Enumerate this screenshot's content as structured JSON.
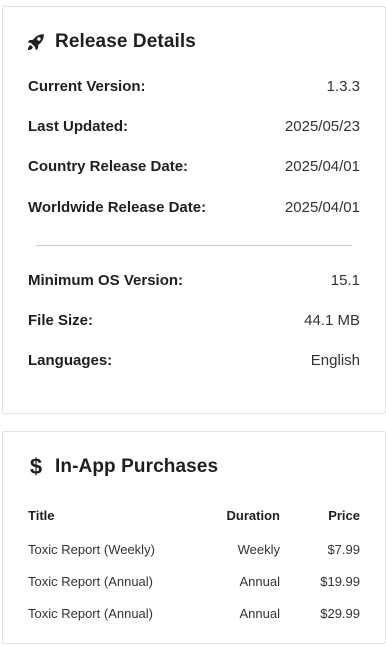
{
  "release": {
    "title": "Release Details",
    "icon": "rocket-icon",
    "details": [
      {
        "label": "Current Version:",
        "value": "1.3.3"
      },
      {
        "label": "Last Updated:",
        "value": "2025/05/23"
      },
      {
        "label": "Country Release Date:",
        "value": "2025/04/01"
      },
      {
        "label": "Worldwide Release Date:",
        "value": "2025/04/01"
      },
      {
        "label": "Minimum OS Version:",
        "value": "15.1"
      },
      {
        "label": "File Size:",
        "value": "44.1 MB"
      },
      {
        "label": "Languages:",
        "value": "English"
      }
    ]
  },
  "iap": {
    "title": "In-App Purchases",
    "icon": "dollar-icon",
    "icon_glyph": "$",
    "headers": {
      "title": "Title",
      "duration": "Duration",
      "price": "Price"
    },
    "rows": [
      {
        "title": "Toxic Report (Weekly)",
        "duration": "Weekly",
        "price": "$7.99"
      },
      {
        "title": "Toxic Report (Annual)",
        "duration": "Annual",
        "price": "$19.99"
      },
      {
        "title": "Toxic Report (Annual)",
        "duration": "Annual",
        "price": "$29.99"
      }
    ]
  }
}
